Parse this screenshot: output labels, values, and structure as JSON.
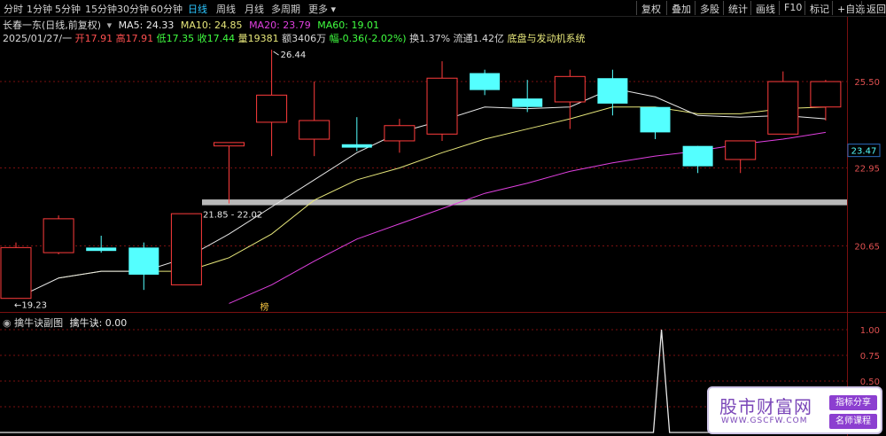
{
  "toolbar": {
    "periods": [
      "分时",
      "1分钟",
      "5分钟",
      "15分钟",
      "30分钟",
      "60分钟",
      "日线",
      "周线",
      "月线",
      "多周期",
      "更多"
    ],
    "active": "日线",
    "right_buttons": [
      "复权",
      "叠加",
      "多股",
      "统计",
      "画线",
      "F10",
      "标记",
      "+自选",
      "返回"
    ]
  },
  "info": {
    "stock": "长春一东(日线,前复权)",
    "ma5": "MA5: 24.33",
    "ma10": "MA10: 24.85",
    "ma20": "MA20: 23.79",
    "ma60": "MA60: 19.01",
    "date": "2025/01/27/一",
    "open": "开17.91",
    "high": "高17.91",
    "low": "低17.35",
    "close": "收17.44",
    "volume": "量19381",
    "amount": "额3406万",
    "change": "幅-0.36(-2.02%)",
    "turnover": "换1.37%",
    "float_cap": "流通1.42亿",
    "system": "底盘与发动机系统"
  },
  "sub_panel": {
    "title": "擒牛诀副图",
    "value_label": "擒牛诀: 0.00"
  },
  "colors": {
    "up": "#ff3c3c",
    "down": "#54ffff",
    "ma5": "#e8e8e8",
    "ma10": "#e6e67a",
    "ma20": "#e040e0",
    "ma60": "#40ff40",
    "grid": "#7a1010"
  },
  "chart_data": [
    {
      "type": "candlestick",
      "title": "长春一东(日线,前复权)",
      "y_ticks": [
        "25.50",
        "22.95",
        "20.65"
      ],
      "ylim": [
        18.7,
        26.6
      ],
      "last_price_label": "23.47",
      "candles": [
        {
          "o": 19.1,
          "h": 20.75,
          "l": 19.1,
          "c": 20.6
        },
        {
          "o": 20.45,
          "h": 21.55,
          "l": 20.4,
          "c": 21.45
        },
        {
          "o": 20.6,
          "h": 20.95,
          "l": 20.45,
          "c": 20.5
        },
        {
          "o": 20.6,
          "h": 20.75,
          "l": 19.35,
          "c": 19.8
        },
        {
          "o": 19.5,
          "h": 21.6,
          "l": 19.5,
          "c": 21.6
        },
        {
          "o": 23.6,
          "h": 23.7,
          "l": 21.9,
          "c": 23.7
        },
        {
          "o": 24.3,
          "h": 26.44,
          "l": 23.3,
          "c": 25.1
        },
        {
          "o": 23.8,
          "h": 25.5,
          "l": 23.3,
          "c": 24.35
        },
        {
          "o": 23.65,
          "h": 24.45,
          "l": 23.45,
          "c": 23.55
        },
        {
          "o": 23.75,
          "h": 24.4,
          "l": 23.4,
          "c": 24.2
        },
        {
          "o": 23.95,
          "h": 26.1,
          "l": 23.75,
          "c": 25.6
        },
        {
          "o": 25.75,
          "h": 25.85,
          "l": 25.1,
          "c": 25.25
        },
        {
          "o": 25.0,
          "h": 25.55,
          "l": 24.6,
          "c": 24.75
        },
        {
          "o": 24.9,
          "h": 25.85,
          "l": 24.1,
          "c": 25.65
        },
        {
          "o": 25.6,
          "h": 25.85,
          "l": 24.5,
          "c": 24.85
        },
        {
          "o": 24.75,
          "h": 24.75,
          "l": 23.8,
          "c": 24.0
        },
        {
          "o": 23.6,
          "h": 23.6,
          "l": 22.8,
          "c": 23.0
        },
        {
          "o": 23.2,
          "h": 23.75,
          "l": 22.8,
          "c": 23.75
        },
        {
          "o": 23.95,
          "h": 25.8,
          "l": 23.95,
          "c": 25.5
        },
        {
          "o": 24.75,
          "h": 25.55,
          "l": 24.35,
          "c": 25.5
        }
      ],
      "ma5": [
        19.1,
        19.7,
        19.9,
        19.9,
        20.3,
        21.0,
        21.8,
        22.6,
        23.4,
        24.0,
        24.35,
        24.75,
        24.7,
        24.75,
        25.3,
        25.05,
        24.5,
        24.45,
        24.5,
        24.4
      ],
      "ma10": [
        null,
        19.7,
        19.9,
        19.9,
        19.9,
        20.3,
        21.0,
        22.0,
        22.6,
        22.95,
        23.4,
        23.8,
        24.1,
        24.4,
        24.75,
        24.75,
        24.55,
        24.55,
        24.7,
        24.75
      ],
      "ma20": [
        null,
        null,
        null,
        null,
        null,
        18.95,
        19.5,
        20.2,
        20.85,
        21.3,
        21.75,
        22.2,
        22.5,
        22.85,
        23.1,
        23.3,
        23.45,
        23.65,
        23.8,
        24.0
      ],
      "annotations": [
        {
          "index": 0,
          "price": 19.23,
          "text": "←19.23"
        },
        {
          "index": 6,
          "price": 26.44,
          "text": "26.44"
        }
      ],
      "support_band": {
        "low": 21.85,
        "high": 22.02,
        "label": "21.85 - 22.02"
      },
      "signal_marker": {
        "index": 5,
        "text": "榜"
      }
    },
    {
      "type": "line",
      "title": "擒牛诀副图",
      "y_ticks": [
        "1.00",
        "0.75",
        "0.50",
        "0.25"
      ],
      "ylim": [
        0,
        1.0
      ],
      "series": [
        {
          "name": "擒牛诀",
          "values": [
            0,
            0,
            0,
            0,
            0,
            0,
            0,
            0,
            0,
            0,
            0,
            0,
            0,
            0,
            0,
            0,
            0,
            0,
            0,
            0,
            0,
            0,
            0,
            0,
            0,
            0,
            0,
            0,
            0,
            0,
            0,
            0,
            0,
            0,
            0,
            0,
            0,
            0,
            0,
            0,
            0,
            0,
            0,
            0,
            0,
            0,
            0,
            0,
            0,
            0,
            0,
            0,
            0,
            0,
            0,
            0,
            0,
            0,
            0,
            0,
            0,
            0,
            0,
            0,
            0,
            0,
            0,
            0,
            0,
            0,
            0,
            0,
            0,
            0,
            0,
            0,
            0,
            0,
            0,
            0,
            0,
            0,
            1,
            0,
            0,
            0,
            0,
            0,
            0,
            0,
            0,
            0,
            0,
            0,
            0,
            0,
            0,
            0,
            0,
            0,
            0,
            0,
            0,
            0,
            0,
            0
          ]
        }
      ]
    }
  ],
  "watermark": {
    "title": "股市财富网",
    "url": "WWW.GSCFW.COM",
    "tag1": "指标分享",
    "tag2": "名师课程"
  }
}
